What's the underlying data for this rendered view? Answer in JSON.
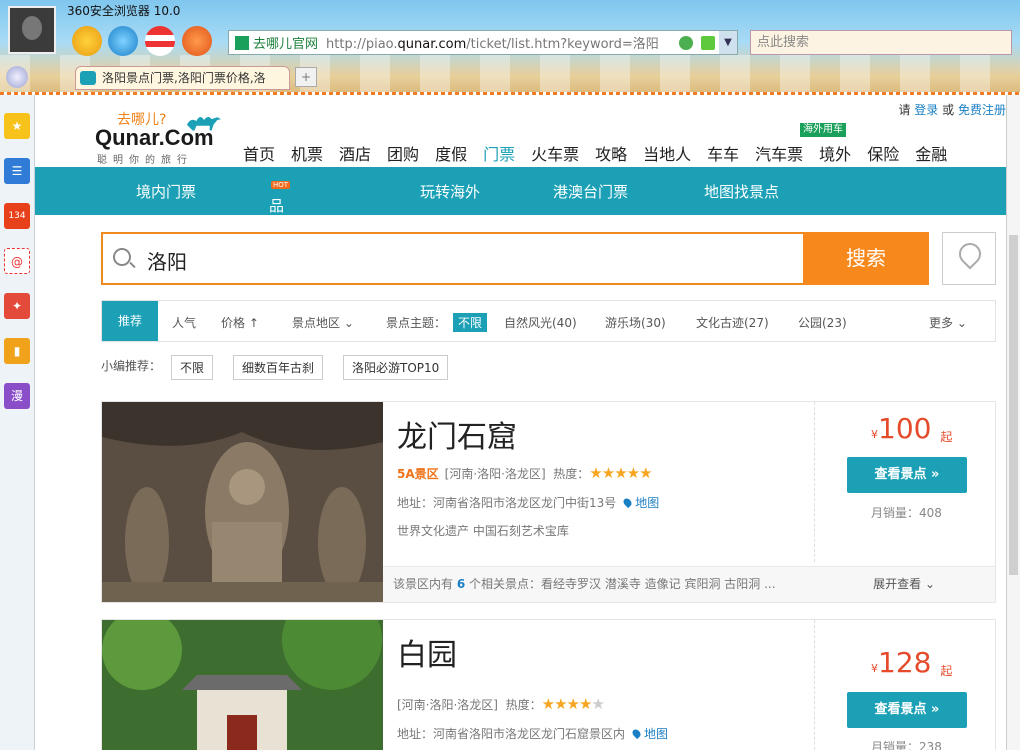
{
  "browser": {
    "title": "360安全浏览器 10.0",
    "address": {
      "site_name": "去哪儿官网",
      "url_prefix": "http://piao.",
      "url_domain": "qunar.com",
      "url_suffix": "/ticket/list.htm?keyword=洛阳"
    },
    "search_placeholder": "点此搜索",
    "tab_title": "洛阳景点门票,洛阳门票价格,洛",
    "new_tab": "+"
  },
  "sidebar": {
    "badge_count": "134",
    "man_label": "漫"
  },
  "header": {
    "logo_tag": "去哪儿?",
    "logo_name": "Qunar.Com",
    "logo_slogan": "聪明你的旅行",
    "login_prefix": "请",
    "login": "登录",
    "or": "或",
    "register": "免费注册",
    "overseas_car_badge": "海外用车",
    "nav": [
      "首页",
      "机票",
      "酒店",
      "团购",
      "度假",
      "门票",
      "火车票",
      "攻略",
      "当地人",
      "车车",
      "汽车票",
      "境外",
      "保险",
      "金融"
    ]
  },
  "subnav": {
    "items": [
      "境内门票",
      "品质一日游",
      "玩转海外",
      "港澳台门票",
      "地图找景点"
    ],
    "hot_badge": "HOT"
  },
  "search": {
    "query": "洛阳",
    "button": "搜索"
  },
  "filters": {
    "recommend": "推荐",
    "popular": "人气",
    "price": "价格",
    "area": "景点地区",
    "theme_label": "景点主题：",
    "themes": [
      "不限",
      "自然风光(40)",
      "游乐场(30)",
      "文化古迹(27)",
      "公园(23)"
    ],
    "more": "更多"
  },
  "picks": {
    "label": "小编推荐：",
    "items": [
      "不限",
      "细数百年古刹",
      "洛阳必游TOP10"
    ]
  },
  "results": [
    {
      "name": "龙门石窟",
      "level": "5A景区",
      "region": "[河南·洛阳·洛龙区]",
      "heat_label": "热度：",
      "stars": 5,
      "address": "地址：河南省洛阳市洛龙区龙门中街13号",
      "map_link": "地图",
      "tags": "世界文化遗产 中国石刻艺术宝库",
      "currency": "¥",
      "price": "100",
      "price_suffix": "起",
      "view_button": "查看景点 »",
      "sales": "月销量：408",
      "related_prefix": "该景区内有",
      "related_count": "6",
      "related_suffix": "个相关景点：看经寺罗汉  潜溪寺  造像记  宾阳洞  古阳洞  ...",
      "expand": "展开查看"
    },
    {
      "name": "白园",
      "level": "",
      "region": "[河南·洛阳·洛龙区]",
      "heat_label": "热度：",
      "stars": 4,
      "address": "地址：河南省洛阳市洛龙区龙门石窟景区内",
      "map_link": "地图",
      "currency": "¥",
      "price": "128",
      "price_suffix": "起",
      "view_button": "查看景点 »",
      "sales": "月销量：238"
    }
  ],
  "colors": {
    "teal": "#1ba0b6",
    "orange": "#f7891c",
    "price_red": "#e54b2b"
  }
}
